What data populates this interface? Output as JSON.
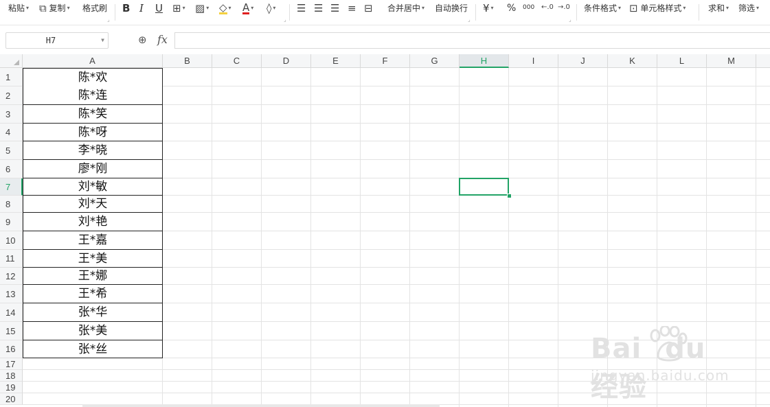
{
  "toolbar": {
    "paste_label": "粘贴",
    "copy_label": "复制",
    "format_painter_label": "格式刷",
    "bold_label": "B",
    "italic_label": "I",
    "underline_label": "U",
    "merge_center_label": "合并居中",
    "wrap_text_label": "自动换行",
    "currency_symbol": "¥",
    "percent_symbol": "%",
    "thousands_symbol": "000",
    "conditional_format_label": "条件格式",
    "cell_style_label": "单元格样式",
    "sum_label": "求和",
    "filter_label": "筛选",
    "icons": [
      "copy-icon",
      "border-icon",
      "fill-color-icon",
      "font-color-icon",
      "eraser-icon",
      "align-left-icon",
      "align-center-icon",
      "align-right-icon",
      "justify-icon",
      "merge-icon",
      "increase-decimal-icon",
      "decrease-decimal-icon",
      "cell-style-icon"
    ]
  },
  "formula_bar": {
    "cell_reference": "H7",
    "fx_label": "fx",
    "content": ""
  },
  "columns": [
    "A",
    "B",
    "C",
    "D",
    "E",
    "F",
    "G",
    "H",
    "I",
    "J",
    "K",
    "L",
    "M"
  ],
  "active_column": "H",
  "active_row": 7,
  "rows": [
    1,
    2,
    3,
    4,
    5,
    6,
    7,
    8,
    9,
    10,
    11,
    12,
    13,
    14,
    15,
    16,
    17,
    18,
    19,
    20
  ],
  "column_a_values": [
    "陈*欢",
    "陈*连",
    "陈*笑",
    "陈*呀",
    "李*晓",
    "廖*刚",
    "刘*敏",
    "刘*天",
    "刘*艳",
    "王*嘉",
    "王*美",
    "王*娜",
    "王*希",
    "张*华",
    "张*美",
    "张*丝"
  ],
  "selection_color": "#21a366",
  "watermark": {
    "brand": "Bai",
    "brand_suffix": "du",
    "brand_cn": "经验",
    "url": "jingyan.baidu.com"
  }
}
